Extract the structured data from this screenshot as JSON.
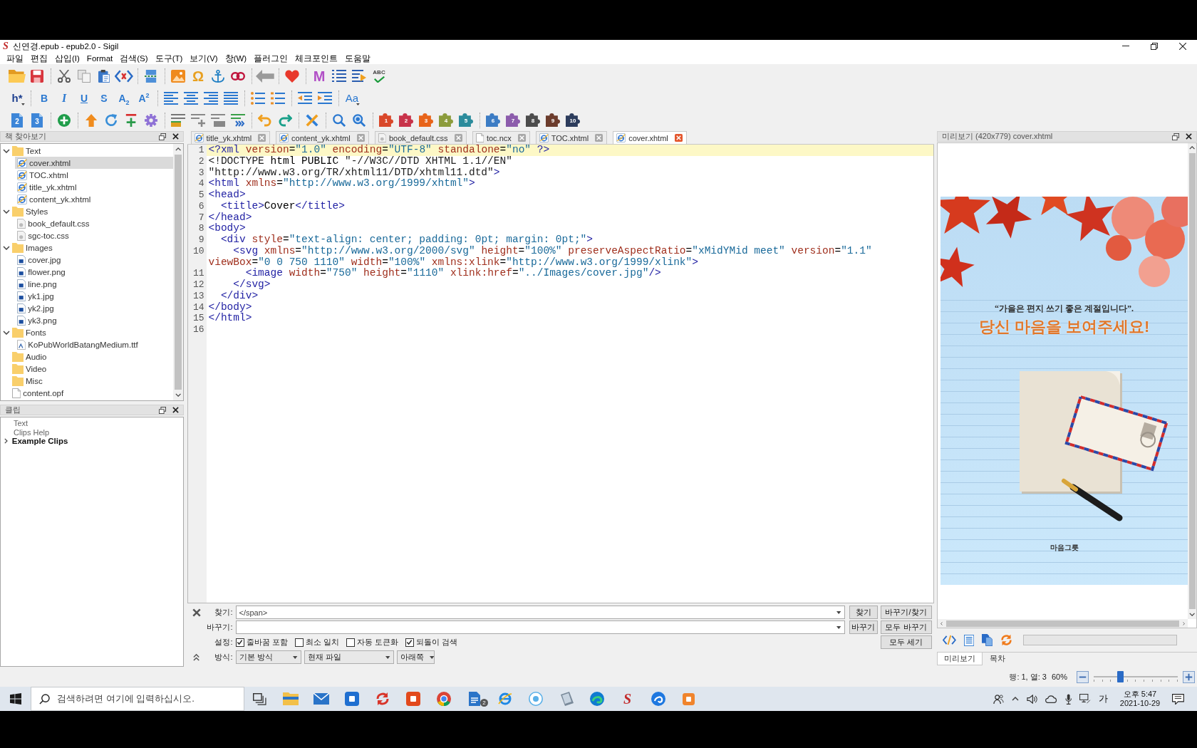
{
  "window": {
    "logo": "S",
    "title": "신연경.epub - epub2.0 - Sigil"
  },
  "menu": [
    "파일",
    "편집",
    "삽입(I)",
    "Format",
    "검색(S)",
    "도구(T)",
    "보기(V)",
    "창(W)",
    "플러그인",
    "체크포인트",
    "도움말"
  ],
  "toolbars": {
    "main": {
      "special_character": "Ω",
      "metadata": "M",
      "spellcheck": "ABC"
    },
    "format": {
      "heading": "h*",
      "bold": "B",
      "italic": "I",
      "underline": "U",
      "strikethrough": "S",
      "subscript": "A$_{2}$",
      "superscript": "A$^{2}$",
      "text_case": "Aa"
    },
    "tools": {
      "heading_levels": [
        "2",
        "3"
      ],
      "plugins": [
        {
          "label": "1",
          "color": "#d9482a"
        },
        {
          "label": "2",
          "color": "#c8334a"
        },
        {
          "label": "3",
          "color": "#e8641a"
        },
        {
          "label": "4",
          "color": "#8c9c3c"
        },
        {
          "label": "5",
          "color": "#2c8c9c"
        },
        {
          "label": "6",
          "color": "#3c7cc4"
        },
        {
          "label": "7",
          "color": "#8c5cac"
        },
        {
          "label": "8",
          "color": "#4c4c4c"
        },
        {
          "label": "9",
          "color": "#6c3c2c"
        },
        {
          "label": "10",
          "color": "#2c3c5c"
        }
      ]
    }
  },
  "book_browser": {
    "title": "책 찾아보기",
    "items": [
      {
        "label": "Text",
        "kind": "folder",
        "expanded": true,
        "selected": false,
        "children": [
          {
            "label": "cover.xhtml",
            "kind": "html",
            "selected": true
          },
          {
            "label": "TOC.xhtml",
            "kind": "html",
            "selected": false
          },
          {
            "label": "title_yk.xhtml",
            "kind": "html",
            "selected": false
          },
          {
            "label": "content_yk.xhtml",
            "kind": "html",
            "selected": false
          }
        ]
      },
      {
        "label": "Styles",
        "kind": "folder",
        "expanded": true,
        "selected": false,
        "children": [
          {
            "label": "book_default.css",
            "kind": "css",
            "selected": false
          },
          {
            "label": "sgc-toc.css",
            "kind": "css",
            "selected": false
          }
        ]
      },
      {
        "label": "Images",
        "kind": "folder",
        "expanded": true,
        "selected": false,
        "children": [
          {
            "label": "cover.jpg",
            "kind": "image",
            "selected": false
          },
          {
            "label": "flower.png",
            "kind": "image",
            "selected": false
          },
          {
            "label": "line.png",
            "kind": "image",
            "selected": false
          },
          {
            "label": "yk1.jpg",
            "kind": "image",
            "selected": false
          },
          {
            "label": "yk2.jpg",
            "kind": "image",
            "selected": false
          },
          {
            "label": "yk3.png",
            "kind": "image",
            "selected": false
          }
        ]
      },
      {
        "label": "Fonts",
        "kind": "folder",
        "expanded": true,
        "selected": false,
        "children": [
          {
            "label": "KoPubWorldBatangMedium.ttf",
            "kind": "font",
            "selected": false
          }
        ]
      },
      {
        "label": "Audio",
        "kind": "folder",
        "selected": false
      },
      {
        "label": "Video",
        "kind": "folder",
        "selected": false
      },
      {
        "label": "Misc",
        "kind": "folder",
        "selected": false
      },
      {
        "label": "content.opf",
        "kind": "opf",
        "selected": false
      }
    ]
  },
  "clips": {
    "title": "클립",
    "items": [
      {
        "label": "Text",
        "kind": "clip",
        "selected": false
      },
      {
        "label": "Clips Help",
        "kind": "clip",
        "selected": false
      },
      {
        "label": "Example Clips",
        "kind": "group",
        "expanded": false,
        "selected": false
      }
    ]
  },
  "tabs": [
    {
      "label": "title_yk.xhtml",
      "kind": "html",
      "selected": false
    },
    {
      "label": "content_yk.xhtml",
      "kind": "html",
      "selected": false
    },
    {
      "label": "book_default.css",
      "kind": "css",
      "selected": false
    },
    {
      "label": "toc.ncx",
      "kind": "ncx",
      "selected": false
    },
    {
      "label": "TOC.xhtml",
      "kind": "html",
      "selected": false
    },
    {
      "label": "cover.xhtml",
      "kind": "html",
      "selected": true
    }
  ],
  "editor": {
    "lines": [
      {
        "number": "1",
        "code": "<?xml version=\"1.0\" encoding=\"UTF-8\" standalone=\"no\" ?>",
        "current": true
      },
      {
        "number": "2",
        "code": "<!DOCTYPE html PUBLIC \"-//W3C//DTD XHTML 1.1//EN\"",
        "current": false
      },
      {
        "number": "3",
        "code": "\"http://www.w3.org/TR/xhtml11/DTD/xhtml11.dtd\">",
        "current": false
      },
      {
        "number": "4",
        "code": "<html xmlns=\"http://www.w3.org/1999/xhtml\">",
        "current": false
      },
      {
        "number": "5",
        "code": "<head>",
        "current": false
      },
      {
        "number": "6",
        "code": "  <title>Cover</title>",
        "current": false
      },
      {
        "number": "7",
        "code": "</head>",
        "current": false
      },
      {
        "number": "8",
        "code": "<body>",
        "current": false
      },
      {
        "number": "9",
        "code": "  <div style=\"text-align: center; padding: 0pt; margin: 0pt;\">",
        "current": false
      },
      {
        "number": "10",
        "code": "    <svg xmlns=\"http://www.w3.org/2000/svg\" height=\"100%\" preserveAspectRatio=\"xMidYMid meet\" version=\"1.1\" viewBox=\"0 0 750 1110\" width=\"100%\" xmlns:xlink=\"http://www.w3.org/1999/xlink\">",
        "current": false
      },
      {
        "number": "11",
        "code": "      <image width=\"750\" height=\"1110\" xlink:href=\"../Images/cover.jpg\"/>",
        "current": false
      },
      {
        "number": "12",
        "code": "    </svg>",
        "current": false
      },
      {
        "number": "13",
        "code": "  </div>",
        "current": false
      },
      {
        "number": "14",
        "code": "</body>",
        "current": false
      },
      {
        "number": "15",
        "code": "</html>",
        "current": false
      },
      {
        "number": "16",
        "current": false
      }
    ]
  },
  "find_bar": {
    "find_label": "찾기:",
    "find_value": "</span>",
    "find_buttons": [
      "찾기",
      "바꾸기/찾기"
    ],
    "replace_label": "바꾸기:",
    "replace_buttons": [
      "바꾸기",
      "모두 바꾸기"
    ],
    "options_label": "설정:",
    "options": [
      {
        "label": "줄바꿈 포함",
        "checked": true
      },
      {
        "label": "최소 일치",
        "checked": false
      },
      {
        "label": "자동 토큰화",
        "checked": false
      },
      {
        "label": "되돌이 검색",
        "checked": true
      }
    ],
    "count_button": "모두 세기",
    "mode_label": "방식:",
    "selects": [
      "기본 방식",
      "현재 파일",
      "아래쪽"
    ]
  },
  "preview": {
    "title": "미리보기 (420x779) cover.xhtml",
    "cover": {
      "quote": "“가을은 편지 쓰기 좋은 계절입니다”.",
      "headline": "당신 마음을 보여주세요!",
      "footer": "마음그릇"
    },
    "progress": {
      "level": 0
    },
    "tabs": [
      {
        "label": "미리보기",
        "selected": true
      },
      {
        "label": "목차",
        "selected": false
      }
    ]
  },
  "status_bar": {
    "position": "행: 1, 열: 3",
    "zoom": "60%",
    "zoom_slider": {
      "level": 0.3
    }
  },
  "taskbar": {
    "search": {
      "placeholder": "검색하려면 여기에 입력하십시오."
    },
    "badge": "2",
    "app_logo": "S",
    "ime": "가",
    "time": "오후 5:47",
    "date": "2021-10-29"
  }
}
